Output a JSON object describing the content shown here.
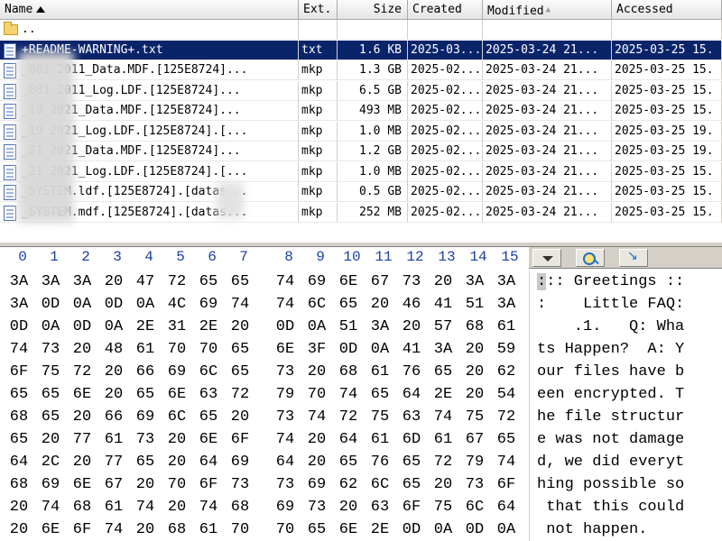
{
  "file_list": {
    "headers": {
      "name": "Name",
      "ext": "Ext.",
      "size": "Size",
      "created": "Created",
      "modified": "Modified",
      "accessed": "Accessed"
    },
    "parent_dir": "..",
    "rows": [
      {
        "name": "+README-WARNING+.txt",
        "ext": "txt",
        "size": "1.6 KB",
        "created": "2025-03...",
        "modified": "2025-03-24  21...",
        "accessed": "2025-03-25  15.",
        "selected": true
      },
      {
        "name": "    _001_2011_Data.MDF.[125E8724]...",
        "ext": "mkp",
        "size": "1.3 GB",
        "created": "2025-02...",
        "modified": "2025-03-24  21...",
        "accessed": "2025-03-25  15.",
        "selected": false
      },
      {
        "name": "    _001_2011_Log.LDF.[125E8724]...",
        "ext": "mkp",
        "size": "6.5 GB",
        "created": "2025-02...",
        "modified": "2025-03-24  21...",
        "accessed": "2025-03-25  15.",
        "selected": false
      },
      {
        "name": "    _19_2021_Data.MDF.[125E8724]...",
        "ext": "mkp",
        "size": "493 MB",
        "created": "2025-02...",
        "modified": "2025-03-24  21...",
        "accessed": "2025-03-25  15.",
        "selected": false
      },
      {
        "name": "    _19_2021_Log.LDF.[125E8724].[...",
        "ext": "mkp",
        "size": "1.0 MB",
        "created": "2025-02...",
        "modified": "2025-03-24  21...",
        "accessed": "2025-03-25  19.",
        "selected": false
      },
      {
        "name": "    _21_2021_Data.MDF.[125E8724]...",
        "ext": "mkp",
        "size": "1.2 GB",
        "created": "2025-02...",
        "modified": "2025-03-24  21...",
        "accessed": "2025-03-25  19.",
        "selected": false
      },
      {
        "name": "    _21_2021_Log.LDF.[125E8724].[...",
        "ext": "mkp",
        "size": "1.0 MB",
        "created": "2025-02...",
        "modified": "2025-03-24  21...",
        "accessed": "2025-03-25  15.",
        "selected": false
      },
      {
        "name": "    _SYSTEM.ldf.[125E8724].[datas...",
        "ext": "mkp",
        "size": "0.5 GB",
        "created": "2025-02...",
        "modified": "2025-03-24  21...",
        "accessed": "2025-03-25  15.",
        "selected": false
      },
      {
        "name": "    _SYSTEM.mdf.[125E8724].[datas...",
        "ext": "mkp",
        "size": "252 MB",
        "created": "2025-02...",
        "modified": "2025-03-24  21...",
        "accessed": "2025-03-25  15.",
        "selected": false
      }
    ]
  },
  "hex_viewer": {
    "column_numbers": [
      "0",
      "1",
      "2",
      "3",
      "4",
      "5",
      "6",
      "7",
      "8",
      "9",
      "10",
      "11",
      "12",
      "13",
      "14",
      "15"
    ],
    "rows": [
      {
        "bytes": [
          "3A",
          "3A",
          "3A",
          "20",
          "47",
          "72",
          "65",
          "65",
          "74",
          "69",
          "6E",
          "67",
          "73",
          "20",
          "3A",
          "3A"
        ],
        "text": "::: Greetings ::"
      },
      {
        "bytes": [
          "3A",
          "0D",
          "0A",
          "0D",
          "0A",
          "4C",
          "69",
          "74",
          "74",
          "6C",
          "65",
          "20",
          "46",
          "41",
          "51",
          "3A"
        ],
        "text": ":    Little FAQ:"
      },
      {
        "bytes": [
          "0D",
          "0A",
          "0D",
          "0A",
          "2E",
          "31",
          "2E",
          "20",
          "0D",
          "0A",
          "51",
          "3A",
          "20",
          "57",
          "68",
          "61"
        ],
        "text": "    .1.   Q: Wha"
      },
      {
        "bytes": [
          "74",
          "73",
          "20",
          "48",
          "61",
          "70",
          "70",
          "65",
          "6E",
          "3F",
          "0D",
          "0A",
          "41",
          "3A",
          "20",
          "59"
        ],
        "text": "ts Happen?  A: Y"
      },
      {
        "bytes": [
          "6F",
          "75",
          "72",
          "20",
          "66",
          "69",
          "6C",
          "65",
          "73",
          "20",
          "68",
          "61",
          "76",
          "65",
          "20",
          "62"
        ],
        "text": "our files have b"
      },
      {
        "bytes": [
          "65",
          "65",
          "6E",
          "20",
          "65",
          "6E",
          "63",
          "72",
          "79",
          "70",
          "74",
          "65",
          "64",
          "2E",
          "20",
          "54"
        ],
        "text": "een encrypted. T"
      },
      {
        "bytes": [
          "68",
          "65",
          "20",
          "66",
          "69",
          "6C",
          "65",
          "20",
          "73",
          "74",
          "72",
          "75",
          "63",
          "74",
          "75",
          "72"
        ],
        "text": "he file structur"
      },
      {
        "bytes": [
          "65",
          "20",
          "77",
          "61",
          "73",
          "20",
          "6E",
          "6F",
          "74",
          "20",
          "64",
          "61",
          "6D",
          "61",
          "67",
          "65"
        ],
        "text": "e was not damage"
      },
      {
        "bytes": [
          "64",
          "2C",
          "20",
          "77",
          "65",
          "20",
          "64",
          "69",
          "64",
          "20",
          "65",
          "76",
          "65",
          "72",
          "79",
          "74"
        ],
        "text": "d, we did everyt"
      },
      {
        "bytes": [
          "68",
          "69",
          "6E",
          "67",
          "20",
          "70",
          "6F",
          "73",
          "73",
          "69",
          "62",
          "6C",
          "65",
          "20",
          "73",
          "6F"
        ],
        "text": "hing possible so"
      },
      {
        "bytes": [
          "20",
          "74",
          "68",
          "61",
          "74",
          "20",
          "74",
          "68",
          "69",
          "73",
          "20",
          "63",
          "6F",
          "75",
          "6C",
          "64"
        ],
        "text": " that this could"
      },
      {
        "bytes": [
          "20",
          "6E",
          "6F",
          "74",
          "20",
          "68",
          "61",
          "70",
          "70",
          "65",
          "6E",
          "2E",
          "0D",
          "0A",
          "0D",
          "0A"
        ],
        "text": " not happen.    "
      }
    ]
  },
  "icons": {
    "folder": "folder-up-icon",
    "file": "document-icon",
    "dropdown": "chevron-down-icon",
    "search": "magnifier-icon",
    "navigate": "jump-arrow-icon"
  },
  "colors": {
    "selection": "#0a246a",
    "column_numbers": "#1a3ea8"
  }
}
